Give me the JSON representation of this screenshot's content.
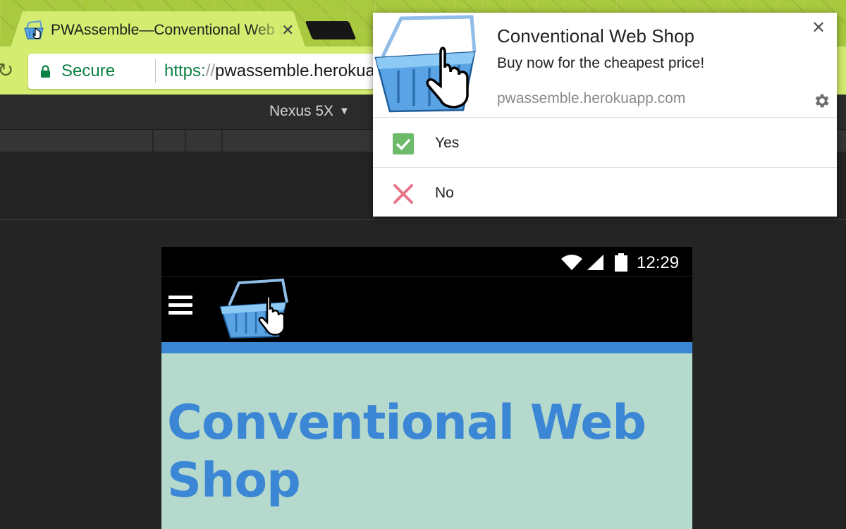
{
  "browser": {
    "tab": {
      "title": "PWAssemble—Conventional Web Shop",
      "close_glyph": "✕",
      "favicon": "shopping-basket-icon"
    },
    "omnibox": {
      "security_label": "Secure",
      "url_scheme": "https:",
      "url_slashes": "//",
      "url_host": "pwassemble.herokuapp.com"
    },
    "reload_glyph": "↻"
  },
  "devtools": {
    "device_label": "Nexus 5X",
    "device_caret": "▼"
  },
  "phone": {
    "status_time": "12:29",
    "hero_title": "Conventional Web Shop",
    "colors": {
      "accent": "#3b87d6",
      "hero_bg": "#b5d9cc",
      "appbar_bg": "#000000"
    }
  },
  "notification": {
    "title": "Conventional Web Shop",
    "body": "Buy now for the cheapest price!",
    "origin": "pwassemble.herokuapp.com",
    "close_glyph": "✕",
    "actions": [
      {
        "label": "Yes",
        "icon": "checkmark-icon",
        "color": "#6dbb6a"
      },
      {
        "label": "No",
        "icon": "cross-icon",
        "color": "#e8738a"
      }
    ]
  },
  "theme": {
    "chrome_green": "#a9c93f",
    "toolbar_green": "#d4ec6f",
    "secure_green": "#0b8043"
  }
}
